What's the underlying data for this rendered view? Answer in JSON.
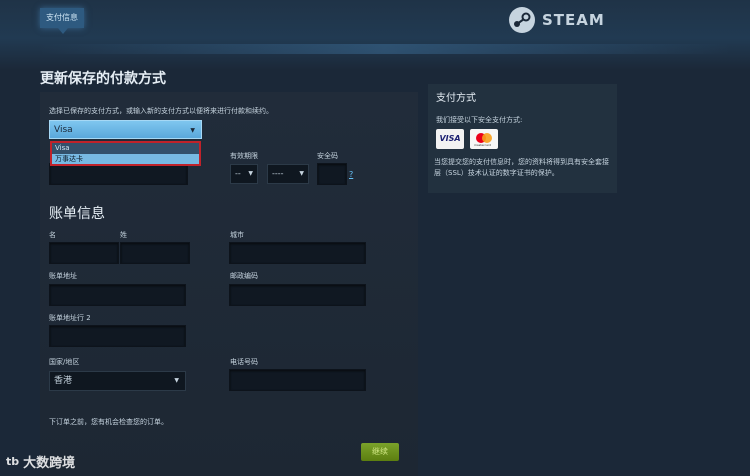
{
  "header": {
    "step_tab": "支付信息",
    "logo_text": "STEAM"
  },
  "page_title": "更新保存的付款方式",
  "payment": {
    "instruction": "选择已保存的支付方式，或输入新的支付方式以便将来进行付款和续约。",
    "method_selected": "Visa",
    "method_options": [
      "Visa",
      "万事达卡"
    ],
    "expiry_label": "有效期限",
    "expiry_month": "--",
    "expiry_year": "----",
    "security_label": "安全码",
    "security_help": "?"
  },
  "billing": {
    "title": "账单信息",
    "first_name_label": "名",
    "last_name_label": "姓",
    "city_label": "城市",
    "address_label": "账单地址",
    "postal_label": "邮政编码",
    "address2_label": "账单地址行 2",
    "country_label": "国家/地区",
    "country_value": "香港",
    "phone_label": "电话号码",
    "footer_note": "下订单之前，您有机会检查您的订单。",
    "continue_button": "继续"
  },
  "sidebar": {
    "title": "支付方式",
    "accept_text": "我们接受以下安全支付方式:",
    "visa_label": "VISA",
    "mastercard_label": "mastercard",
    "note": "当您提交您的支付信息时，您的资料将得到具有安全套接层（SSL）技术认证的数字证书的保护。"
  },
  "watermark": {
    "mark": "tb",
    "text": "大数跨境"
  },
  "colors": {
    "background": "#1b2838",
    "accent": "#66c0f4",
    "button_green": "#5c7e10",
    "highlight_red": "#c0222a"
  }
}
